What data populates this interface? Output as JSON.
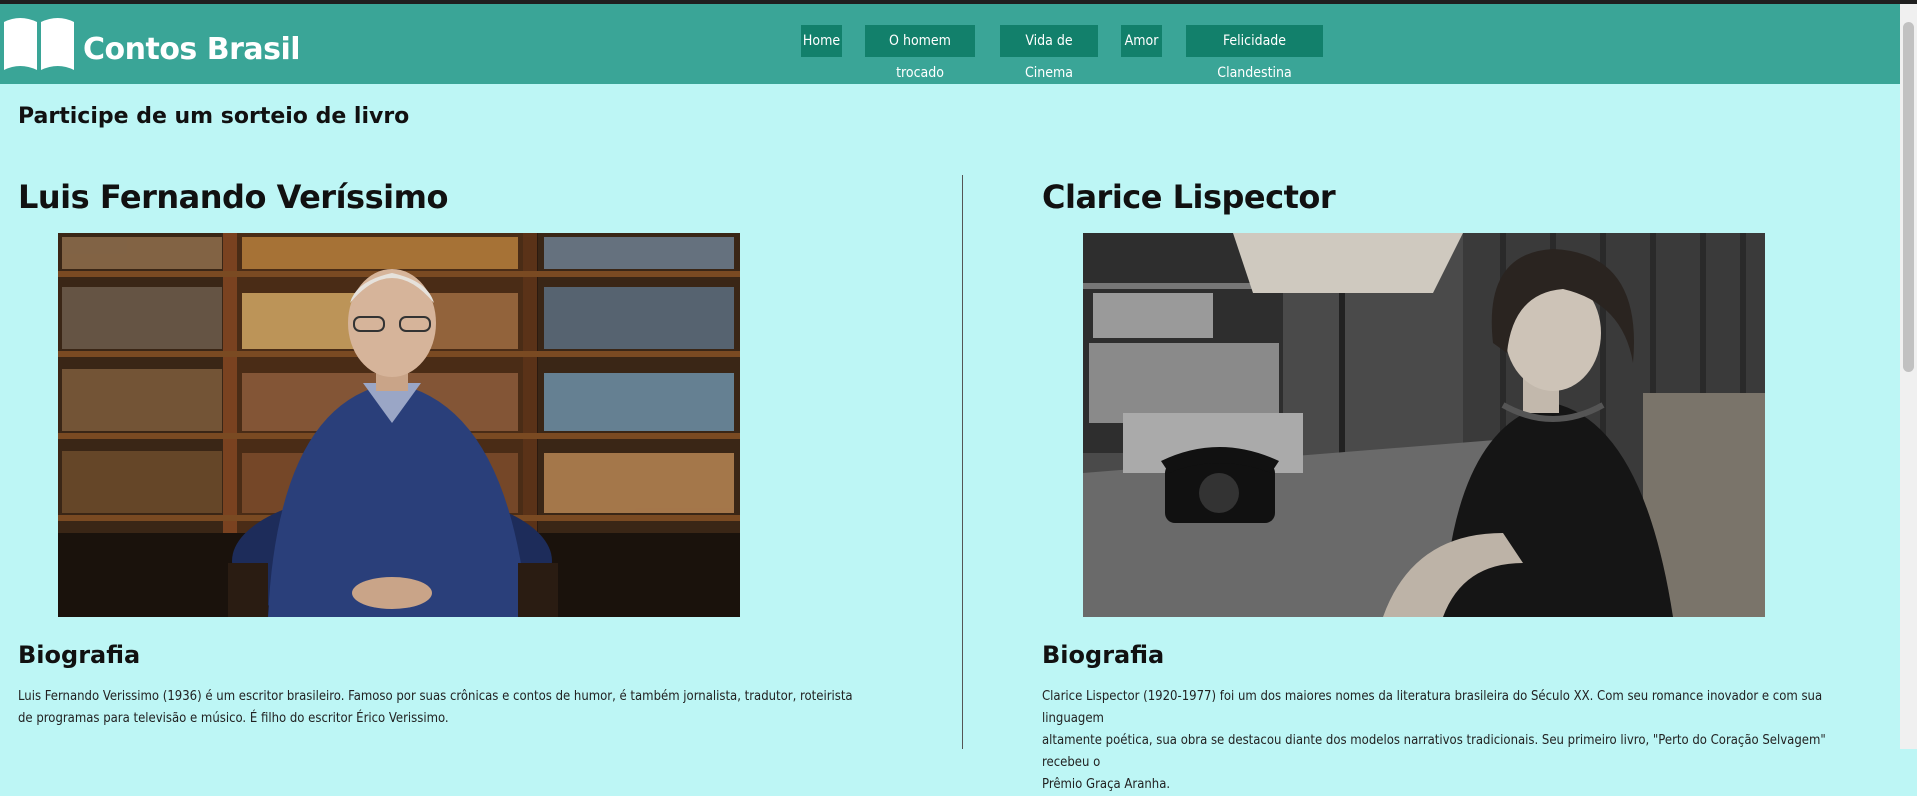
{
  "header": {
    "brand": "Contos Brasil",
    "logo_icon": "open-book-icon",
    "nav": [
      "Home",
      "O homem trocado",
      "Vida de Cinema",
      "Amor",
      "Felicidade Clandestina"
    ]
  },
  "main": {
    "sorteio": "Participe de um sorteio de livro",
    "authors": [
      {
        "name": "Luis Fernando Veríssimo",
        "bio_title": "Biografia",
        "bio_lines": [
          "Luis Fernando Verissimo (1936) é um escritor brasileiro. Famoso por suas crônicas e contos de humor, é também jornalista, tradutor, roteirista",
          "de programas para televisão e músico. É filho do escritor Érico Verissimo."
        ]
      },
      {
        "name": "Clarice Lispector",
        "bio_title": "Biografia",
        "bio_lines": [
          "Clarice Lispector (1920-1977) foi um dos maiores nomes da literatura brasileira do Século XX. Com seu romance inovador e com sua linguagem",
          "altamente poética, sua obra se destacou diante dos modelos narrativos tradicionais. Seu primeiro livro, \"Perto do Coração Selvagem\" recebeu o",
          "Prêmio Graça Aranha."
        ]
      }
    ]
  },
  "colors": {
    "page_bg": "#bdf6f5",
    "header_bg": "#3aa597",
    "nav_bg": "#12806b"
  }
}
